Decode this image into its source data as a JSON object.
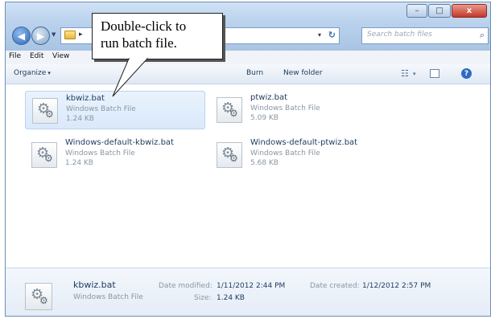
{
  "window": {
    "controls": {
      "minimize": "–",
      "maximize": "□",
      "close": "x"
    }
  },
  "address": {
    "arrow": "▸",
    "dropdown": "▾",
    "refresh": "↻"
  },
  "search": {
    "placeholder": "Search batch files",
    "icon": "⌕"
  },
  "menu": {
    "items": [
      "File",
      "Edit",
      "View"
    ]
  },
  "toolbar": {
    "organize": "Organize",
    "burn": "Burn",
    "new_folder": "New folder",
    "chevron": "▾",
    "help": "?"
  },
  "files": [
    {
      "name": "kbwiz.bat",
      "type": "Windows Batch File",
      "size": "1.24 KB",
      "selected": true
    },
    {
      "name": "ptwiz.bat",
      "type": "Windows Batch File",
      "size": "5.09 KB",
      "selected": false
    },
    {
      "name": "Windows-default-kbwiz.bat",
      "type": "Windows Batch File",
      "size": "1.24 KB",
      "selected": false
    },
    {
      "name": "Windows-default-ptwiz.bat",
      "type": "Windows Batch File",
      "size": "5.68 KB",
      "selected": false
    }
  ],
  "details": {
    "name": "kbwiz.bat",
    "type": "Windows Batch File",
    "modified_label": "Date modified:",
    "modified_value": "1/11/2012 2:44 PM",
    "created_label": "Date created:",
    "created_value": "1/12/2012 2:57 PM",
    "size_label": "Size:",
    "size_value": "1.24 KB"
  },
  "callout": {
    "line1": "Double-click to",
    "line2": "run batch file."
  },
  "colors": {
    "selection": "#d9e9fb",
    "accent": "#2d6bc4",
    "file_text": "#1d3a5c"
  }
}
